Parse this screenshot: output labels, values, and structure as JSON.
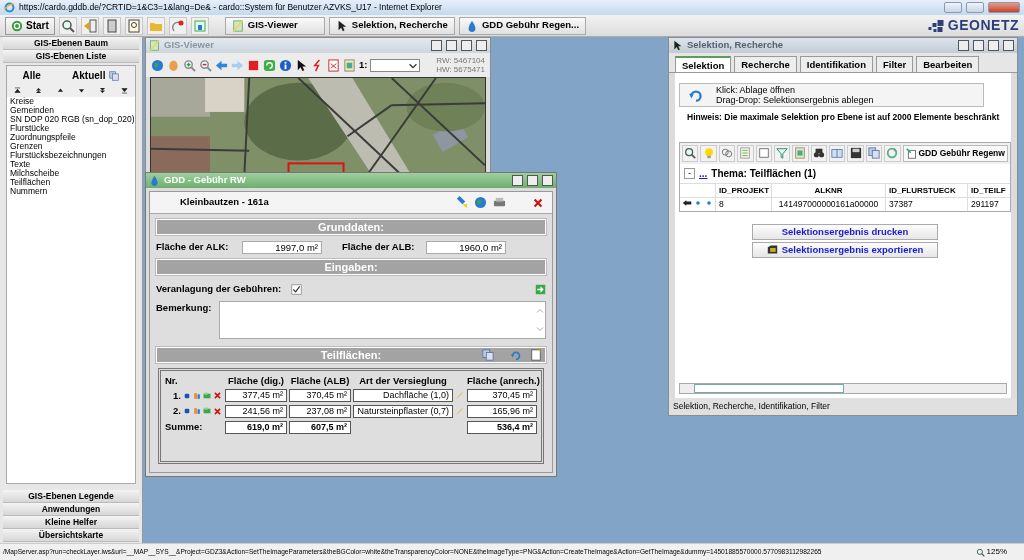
{
  "browser": {
    "title": "https://cardo.gddb.de/?CRTID=1&C3=1&lang=De& - cardo::System für Benutzer AZVKS_U17 - Internet Explorer",
    "status_url": "/MapServer.asp?run=checkLayer.iws&url=__MAP__SYS__&Project=GDZ3&Action=SetTheImageParameters&theBGColor=white&theTransparencyColor=NONE&theImageType=PNG&Action=CreateTheImage&Action=GetTheImage&dummy=14501885570000.5770983112982265",
    "zoom": "125%"
  },
  "toolbar": {
    "start": "Start",
    "tasks": [
      {
        "label": "GIS-Viewer"
      },
      {
        "label": "Selektion, Recherche"
      },
      {
        "label": "GDD Gebühr Regen..."
      }
    ]
  },
  "logo": "GEONETZ",
  "sidebar": {
    "top_sections": [
      "GIS-Ebenen Baum",
      "GIS-Ebenen Liste"
    ],
    "filters": [
      "Alle",
      "Aktuell"
    ],
    "layers": [
      "Kreise",
      "Gemeinden",
      "SN DOP 020 RGB (sn_dop_020)",
      "Flurstücke",
      "Zuordnungspfeile",
      "Grenzen",
      "Flurstücksbezeichnungen",
      "Texte",
      "Milchscheibe",
      "Teilflächen",
      "Nummern"
    ],
    "bottom_sections": [
      "GIS-Ebenen Legende",
      "Anwendungen",
      "Kleine Helfer",
      "Übersichtskarte"
    ]
  },
  "gis_viewer": {
    "title": "GIS-Viewer",
    "scale_label": "1:",
    "rw": "RW: 5467104",
    "hw": "HW: 5675471"
  },
  "gdd": {
    "title": "GDD - Gebühr RW",
    "parcel": "Kleinbautzen - 161a",
    "sections": [
      "Grunddaten:",
      "Eingaben:",
      "Teilflächen:"
    ],
    "alk": {
      "label": "Fläche der ALK:",
      "value": "1997,0 m²"
    },
    "alb": {
      "label": "Fläche der ALB:",
      "value": "1960,0 m²"
    },
    "veranlagung": {
      "label": "Veranlagung der Gebühren:",
      "checked": true
    },
    "bemerkung": {
      "label": "Bemerkung:"
    },
    "table": {
      "columns": [
        "Nr.",
        "Fläche (dig.)",
        "Fläche (ALB)",
        "Art der Versieglung",
        "Fläche (anrech.)"
      ],
      "rows": [
        {
          "nr": "1.",
          "dig": "377,45 m²",
          "alb": "370,45 m²",
          "art": "Dachfläche (1,0)",
          "anrech": "370,45 m²"
        },
        {
          "nr": "2.",
          "dig": "241,56 m²",
          "alb": "237,08 m²",
          "art": "Natursteinpflaster (0,7)",
          "anrech": "165,96 m²"
        }
      ],
      "sum": {
        "label": "Summe:",
        "dig": "619,0 m²",
        "alb": "607,5 m²",
        "anrech": "536,4 m²"
      }
    }
  },
  "selektion": {
    "title": "Selektion, Recherche",
    "tabs": [
      {
        "label": "Selektion",
        "selected": true
      },
      {
        "label": "Recherche",
        "selected": false
      },
      {
        "label": "Identifikation",
        "selected": false
      },
      {
        "label": "Filter",
        "selected": false
      },
      {
        "label": "Bearbeiten",
        "selected": false
      }
    ],
    "ablage": [
      "Klick: Ablage öffnen",
      "Drag-Drop: Selektionsergebnis ablegen"
    ],
    "hint": "Hinweis: Die maximale Selektion pro Ebene ist auf 2000 Elemente beschränkt",
    "toolbar_button": "GDD Gebühr Regenw",
    "collapse": "-",
    "more": "...",
    "theme": "Thema: Teilflächen (1)",
    "table": {
      "columns": [
        "ID_PROJEKT",
        "ALKNR",
        "ID_FLURSTUECK",
        "ID_TEILF"
      ],
      "rows": [
        [
          "8",
          "141497000000161a00000",
          "37387",
          "291197"
        ]
      ]
    },
    "actions": [
      "Selektionsergebnis drucken",
      "Selektionsergebnis exportieren"
    ],
    "footer": "Selektion, Recherche, Identifikation, Filter"
  }
}
